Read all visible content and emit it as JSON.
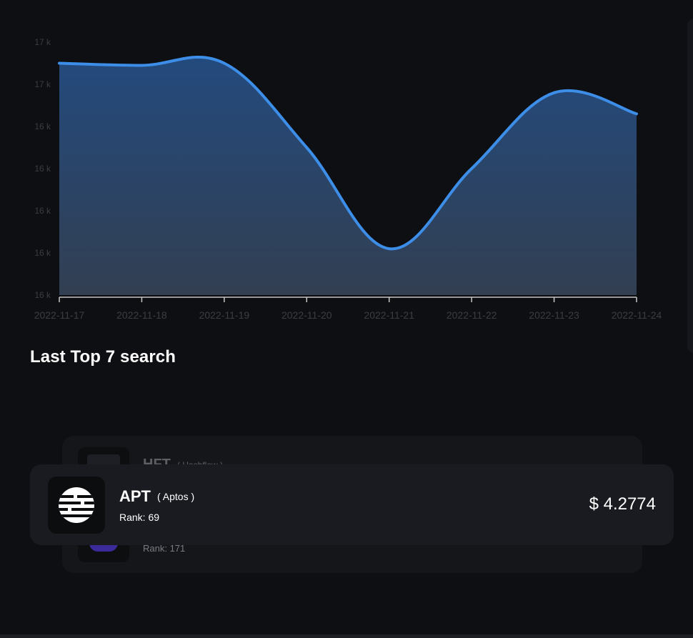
{
  "chart_data": {
    "type": "area",
    "x": [
      "2022-11-17",
      "2022-11-18",
      "2022-11-19",
      "2022-11-20",
      "2022-11-21",
      "2022-11-22",
      "2022-11-23",
      "2022-11-24"
    ],
    "values": [
      16.54,
      16.535,
      16.54,
      16.34,
      16.1,
      16.29,
      16.47,
      16.42
    ],
    "ylim": [
      15.99,
      16.59
    ],
    "y_ticks": [
      15.99,
      16.09,
      16.19,
      16.29,
      16.39,
      16.49,
      16.59
    ],
    "y_tick_labels": [
      "16 k",
      "16 k",
      "16 k",
      "16 k",
      "16 k",
      "17 k",
      "17 k"
    ],
    "x_tick_labels": [
      "2022-11-17",
      "2022-11-18",
      "2022-11-19",
      "2022-11-20",
      "2022-11-21",
      "2022-11-22",
      "2022-11-23",
      "2022-11-24"
    ],
    "grid": false,
    "colors": {
      "line": "#3d8ee8",
      "fill_top": "#234a7d",
      "fill_bottom": "#323f52",
      "tick_label": "#3b3d43",
      "axis": "#c8c8c8"
    }
  },
  "section": {
    "title": "Last Top 7 search"
  },
  "coins": {
    "active": {
      "symbol": "APT",
      "name": "( Aptos )",
      "rank": "Rank: 69",
      "price": "$ 4.2774",
      "icon": "aptos-logo-icon"
    },
    "behind_top": {
      "symbol": "HFT",
      "name": "( Hashflow )"
    },
    "behind_bottom": {
      "rank": "Rank: 171"
    }
  }
}
